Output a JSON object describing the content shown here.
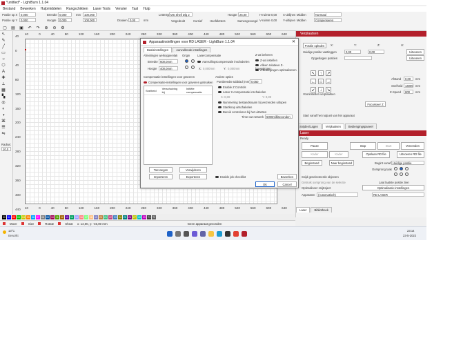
{
  "window": {
    "title": "*untitled* - LightBurn 1.1.04"
  },
  "menu": [
    "Bestand",
    "Bewerken",
    "Hulpmiddelen",
    "Rangschikken",
    "Laser Tools",
    "Venster",
    "Taal",
    "Hulp"
  ],
  "toolbar": {
    "pos_x_label": "Positie op X",
    "pos_x": "0,000",
    "pos_y_label": "Positie op Y",
    "pos_y": "0,000",
    "width_label": "Breedte",
    "width": "0,000",
    "height_label": "Hoogte",
    "height": "0,000",
    "unit": "mm",
    "pct1": "100,000",
    "pct2": "100,000",
    "rotate_label": "Draaien",
    "rotate": "0,00",
    "unit2": "mm",
    "font_label": "Lettertype",
    "font": "MS Shell Dlg 2",
    "font_height_label": "Hoogte",
    "font_height": "25,00",
    "hspace_label": "H-ruimte",
    "hspace": "0,00",
    "vspace_label": "V-ruimte",
    "vspace": "0,00",
    "align_x_label": "X-uitlijnen",
    "align_x": "Midden",
    "align_y_label": "Y-uitlijnen",
    "align_y": "Midden",
    "mode": "Normaal",
    "comp": "Compenseren",
    "bold": "Vetgedrukt",
    "italic": "Cursief",
    "caps": "Hoofdletters",
    "welded": "Samengevoegd"
  },
  "rulers": {
    "top": [
      "40",
      "0",
      "40",
      "80",
      "120",
      "160",
      "200",
      "240",
      "280",
      "320",
      "360",
      "400",
      "440",
      "480",
      "520",
      "560",
      "600",
      "640"
    ],
    "left": [
      "40",
      "0",
      "40",
      "80",
      "120",
      "160",
      "200",
      "240",
      "280",
      "320",
      "360",
      "400",
      "440"
    ],
    "bottom": [
      "40",
      "0",
      "40",
      "80",
      "120",
      "160",
      "200",
      "240",
      "280",
      "320",
      "360",
      "400",
      "440",
      "480",
      "520",
      "560",
      "600",
      "640"
    ]
  },
  "dialog": {
    "title": "Apparaatinstellingen voor RD LASER - LightBurn 1.1.04",
    "tabs": [
      "Basisinstellingen",
      "Aanvullende instellingen"
    ],
    "work_area": "Afmetingen werkoppervlak",
    "origin": "Origin",
    "laser_comp": "Lasercompensatie",
    "width_label": "Breedte",
    "width": "600,0mm",
    "height_label": "Hoogte",
    "height": "400,0mm",
    "enable_laser_comp": "Aanvullingscompensatie inschakelen",
    "x_label": "X:",
    "x_val": "0,000mm",
    "y_label": "Y:",
    "y_val": "0,000mm",
    "z_title": "Z-as beheren",
    "z_items": [
      "Z-as instellen",
      "Alleen relatieve Z-bewegingen",
      "Z-bewegingen optimaliseren"
    ],
    "scan_comp": "Compensatie-instellingen voor graveren",
    "scan_comp_enable": "Compensatie-instellingen voor graveren gebruiken",
    "scan_cols": [
      "Snelheid",
      "Verschuiving bij",
      "Initiële compensatie"
    ],
    "other_title": "Andere opties",
    "bed_label": "Puntbreedte tabblad (mm)",
    "bed_val": "0,050",
    "options": [
      "Enable Z Controls",
      "Laser 2-compensatie inschakelen",
      "Nummering bestandsnaam bij verzenden uitlopen",
      "Startknop uitschakelen",
      "Bereik controleren bij het uitzetten"
    ],
    "x2": "X: 0,00",
    "y2": "Y: 0,00",
    "timeout_label": "Time-out netwerk",
    "timeout_val": "5000milliseconden",
    "buttons": {
      "add": "Toevoegen",
      "remove": "Verwijderen",
      "import": "Importeren",
      "export": "Exporteren",
      "job": "Enable job checklist",
      "edit": "Bewerken",
      "ok": "OK",
      "cancel": "Cancel"
    }
  },
  "move_panel": {
    "header": "Verplaatsen",
    "get_pos": "Positie ophalen",
    "x": "X:",
    "y": "Y:",
    "z": "Z:",
    "u": "U:",
    "save_pos": "Huidige positie vastleggen",
    "xv": "0,00",
    "yv": "0,00",
    "go": "Uitvoeren",
    "saved_pos": "Opgeslagen posities",
    "distance": "Afstand",
    "dist_val": "0,00",
    "dist_unit": "mm",
    "speed": "Snelheid",
    "speed_val": "14000",
    "speed_unit": "mm",
    "zspeed": "Z-Speed",
    "zspeed_val": "600",
    "zspeed_unit": "mm",
    "focus_move": "Voorinstellen verplaatsen",
    "focus_z": "Focusseer Z",
    "start_pos": "Start vanaf het nulpunt van het apparaat"
  },
  "laser_panel": {
    "tabs": [
      "Snijden/Lagen",
      "Verplaatsen",
      "Bediengingspaneel"
    ],
    "header": "Laser",
    "state": "Ready",
    "pause": "Pauze",
    "stop": "Stop",
    "start": "Start",
    "send": "Verzenden",
    "frame": "Kader",
    "frame2": "Kader",
    "save_rd": "Opslaan RD file",
    "run_rd": "Uitvoeren RD file",
    "home": "Beginstand",
    "go_origin": "Naar beginstand",
    "start_from": "Begint vanaf",
    "start_from_val": "Huidige positie",
    "job_origin": "Oorsprong taak",
    "cut_sel": "Snijd geselecteerde objecten",
    "use_sel": "Gebruik oorsprong van de selectie",
    "show_last": "Laat laatste positie zien",
    "optimize": "Optimaliseer snijtraject",
    "opt_settings": "Optimalisatie-instellingen",
    "devices": "Apparaten",
    "auto": "(Automatisch)",
    "device": "RD LASER",
    "bottom_tabs": [
      "Laser",
      "Bibliotheek"
    ]
  },
  "palette": [
    "00",
    "01",
    "02",
    "03",
    "04",
    "05",
    "06",
    "07",
    "08",
    "09",
    "10",
    "11",
    "12",
    "13",
    "14",
    "15",
    "16",
    "17",
    "18",
    "19",
    "20",
    "21",
    "22",
    "23",
    "24",
    "25",
    "26",
    "27",
    "28",
    "29",
    "T1",
    "T2"
  ],
  "palette_colors": [
    "#000000",
    "#0000ff",
    "#ff0000",
    "#00c000",
    "#c8c800",
    "#ff8000",
    "#00a0ff",
    "#ff00ff",
    "#808080",
    "#0050a0",
    "#a00050",
    "#50a000",
    "#a06000",
    "#6000a0",
    "#00a060",
    "#a0a0ff",
    "#ff8080",
    "#80ff80",
    "#ffc080",
    "#8080c0",
    "#c08040",
    "#40c080",
    "#c04080",
    "#4080c0",
    "#808000",
    "#008080",
    "#800080",
    "#c0c000",
    "#00c0c0",
    "#c000c0",
    "#404040",
    "#606060"
  ],
  "status": {
    "move": "Move",
    "size": "Size",
    "rotate": "Rotate",
    "shear": "Shear",
    "coords": "x: 14,00, y: -45,00 mm",
    "device": "Geen apparaat gevonden"
  },
  "taskbar": {
    "temp": "13°C",
    "weather": "Bewolkt",
    "time": "23:14",
    "date": "23-5-2022"
  },
  "sidebar": {
    "radius_label": "Radius:",
    "radius": "10,0"
  }
}
